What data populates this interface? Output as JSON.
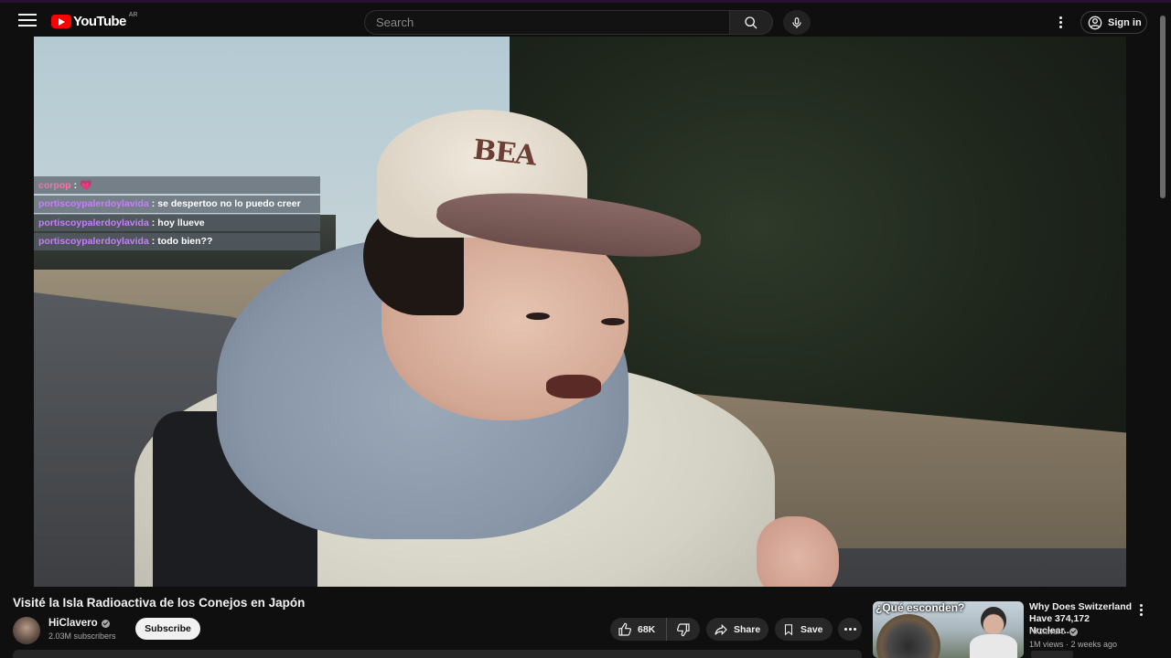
{
  "header": {
    "logo_text": "YouTube",
    "country_code": "AR",
    "search_placeholder": "Search",
    "signin_label": "Sign in"
  },
  "chat": [
    {
      "user": "corpop",
      "message": "",
      "emoji": "💗",
      "user_color": "#ff6fa8"
    },
    {
      "user": "portiscoypalerdoylavida",
      "message": "se despertoo no lo puedo creer",
      "user_color": "#c77dff"
    },
    {
      "user": "portiscoypalerdoylavida",
      "message": "hoy llueve",
      "user_color": "#c77dff"
    },
    {
      "user": "portiscoypalerdoylavida",
      "message": "todo bien??",
      "user_color": "#c77dff"
    }
  ],
  "video": {
    "title": "Visité la Isla Radioactiva de los Conejos en Japón",
    "channel_name": "HiClavero",
    "subscribers": "2.03M subscribers",
    "subscribe_label": "Subscribe",
    "likes": "68K",
    "share_label": "Share",
    "save_label": "Save"
  },
  "recommendation": {
    "thumb_text": "¿Qué esconden?",
    "title": "Why Does Switzerland Have 374,172 Nuclear...",
    "channel": "HiClavero",
    "meta": "1M views · 2 weeks ago"
  },
  "colors": {
    "background": "#0f0f0f",
    "brand_red": "#ff0000",
    "pill_bg": "#272727"
  }
}
